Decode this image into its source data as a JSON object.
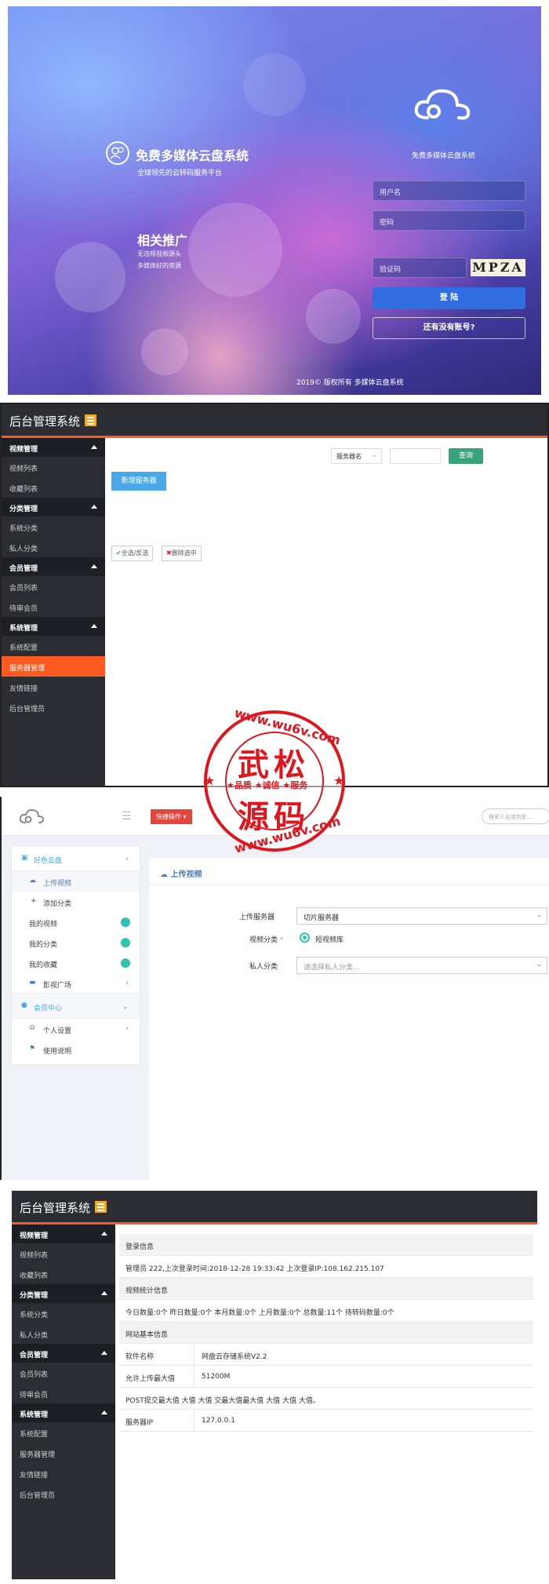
{
  "login": {
    "site_name": "免费多媒体云盘系统",
    "slogan": "全球领先的云转码服务平台",
    "promo_title": "相关推广",
    "promo_line1": "无违规视频源头",
    "promo_line2": "多媒体好的资源",
    "panel_title": "免费多媒体云盘系统",
    "username_placeholder": "用户名",
    "password_placeholder": "密码",
    "captcha_placeholder": "验证码",
    "captcha_text": "MPZA",
    "login_button": "登 陆",
    "register_button": "还有没有账号?",
    "footer": "2019© 版权所有 多媒体云盘系统"
  },
  "admin": {
    "brand": "后台管理系统",
    "search_select": "服务器名",
    "search_button": "查询",
    "add_server_button": "新增服务器",
    "select_all_button": "全选/反选",
    "delete_selected_button": "删除选中",
    "sidebar": [
      {
        "group": "视频管理",
        "items": [
          "视频列表",
          "收藏列表"
        ]
      },
      {
        "group": "分类管理",
        "items": [
          "系统分类",
          "私人分类"
        ]
      },
      {
        "group": "会员管理",
        "items": [
          "会员列表",
          "待审会员"
        ]
      },
      {
        "group": "系统管理",
        "items": [
          "系统配置",
          "服务器管理",
          "友情链接",
          "后台管理员"
        ]
      }
    ],
    "active_item": "服务器管理"
  },
  "user": {
    "quick_button": "快捷操作",
    "search_placeholder": "搜索人名或剪影...",
    "nav_group1": "好色云盘",
    "nav_items1": [
      "上传视频",
      "添加分类",
      "我的视频",
      "我的分类",
      "我的收藏",
      "影视广场"
    ],
    "nav_group2": "会员中心",
    "nav_items2": [
      "个人设置",
      "使用说明"
    ],
    "page_title": "上传视频",
    "label_server": "上传服务器",
    "value_server": "切片服务器",
    "label_category": "视频分类",
    "value_category": "短视频库",
    "label_private": "私人分类",
    "placeholder_private": "请选择私人分类..."
  },
  "dashboard": {
    "sec_login": "登录信息",
    "login_info": "管理员 222,上次登录时间:2018-12-28 19:33:42 上次登录IP:108.162.215.107",
    "sec_stats": "视频统计信息",
    "stats_info": "今日数量:0个 昨日数量:0个 本月数量:0个 上月数量:0个 总数量:11个 待转码数量:0个",
    "sec_site": "网站基本信息",
    "rows": [
      {
        "k": "软件名称",
        "v": "网盘云存储系统V2.2"
      },
      {
        "k": "允许上传最大值",
        "v": "51200M"
      }
    ],
    "post_line": "POST提交最大值 大值 大值 交最大值最大值 大值 大值 大值。",
    "server_ip_label": "服务器IP",
    "server_ip": "127.0.0.1"
  },
  "watermark": {
    "url_top": "www.wu6v.com",
    "big1": "武松",
    "mid": "★品质 ★诚信 ★服务",
    "big2": "源码",
    "url_bottom": "www.wu6v.com"
  },
  "colors": {
    "accent": "#ff5a1f",
    "dark": "#2b2d33",
    "green": "#3aa37c",
    "blue": "#4aa8e8",
    "watermark": "#e0161e"
  }
}
